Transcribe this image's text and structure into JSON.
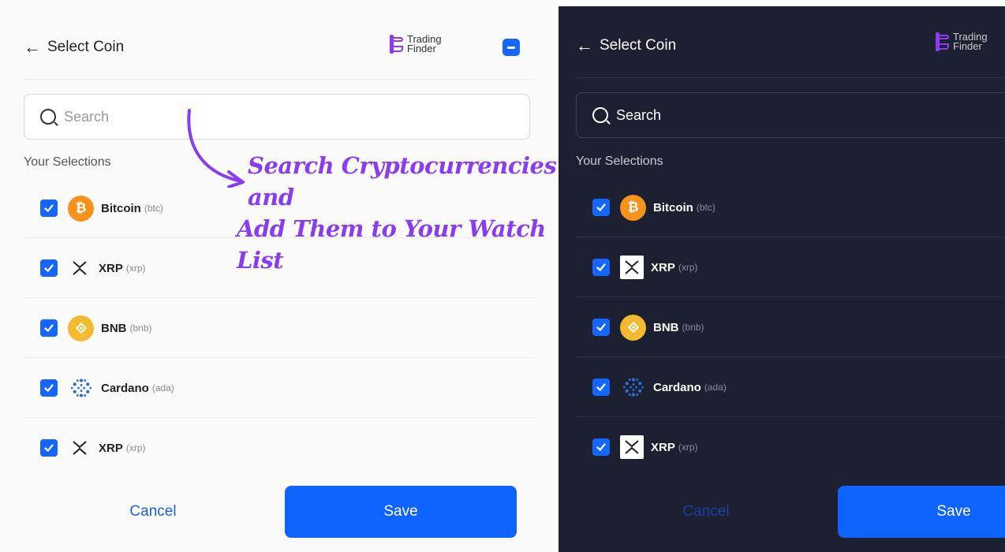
{
  "light": {
    "header": {
      "back_icon": "arrow-left-icon",
      "title": "Select Coin",
      "logo_line1": "Trading",
      "logo_line2": "Finder"
    },
    "search": {
      "placeholder": "Search"
    },
    "selections_label": "Your Selections",
    "coins": [
      {
        "name": "Bitcoin",
        "symbol": "(btc)",
        "icon": "bitcoin-icon",
        "checked": true
      },
      {
        "name": "XRP",
        "symbol": "(xrp)",
        "icon": "xrp-icon",
        "checked": true
      },
      {
        "name": "BNB",
        "symbol": "(bnb)",
        "icon": "bnb-icon",
        "checked": true
      },
      {
        "name": "Cardano",
        "symbol": "(ada)",
        "icon": "cardano-icon",
        "checked": true
      },
      {
        "name": "XRP",
        "symbol": "(xrp)",
        "icon": "xrp-icon",
        "checked": true
      }
    ],
    "cancel_label": "Cancel",
    "save_label": "Save"
  },
  "dark": {
    "header": {
      "back_icon": "arrow-left-icon",
      "title": "Select Coin",
      "logo_line1": "Trading",
      "logo_line2": "Finder"
    },
    "search": {
      "placeholder": "Search"
    },
    "selections_label": "Your Selections",
    "coins": [
      {
        "name": "Bitcoin",
        "symbol": "(btc)",
        "icon": "bitcoin-icon",
        "checked": true
      },
      {
        "name": "XRP",
        "symbol": "(xrp)",
        "icon": "xrp-icon",
        "checked": true
      },
      {
        "name": "BNB",
        "symbol": "(bnb)",
        "icon": "bnb-icon",
        "checked": true
      },
      {
        "name": "Cardano",
        "symbol": "(ada)",
        "icon": "cardano-icon",
        "checked": true
      },
      {
        "name": "XRP",
        "symbol": "(xrp)",
        "icon": "xrp-icon",
        "checked": true
      }
    ],
    "cancel_label": "Cancel",
    "save_label": "Save"
  },
  "annotation": {
    "line1": "Search Cryptocurrencies and",
    "line2": "Add Them to Your Watch List"
  },
  "colors": {
    "accent": "#1565ff",
    "brand_purple": "#8a3df0",
    "bitcoin": "#f7931a",
    "bnb": "#f3ba2f",
    "dark_bg": "#1d2030"
  }
}
